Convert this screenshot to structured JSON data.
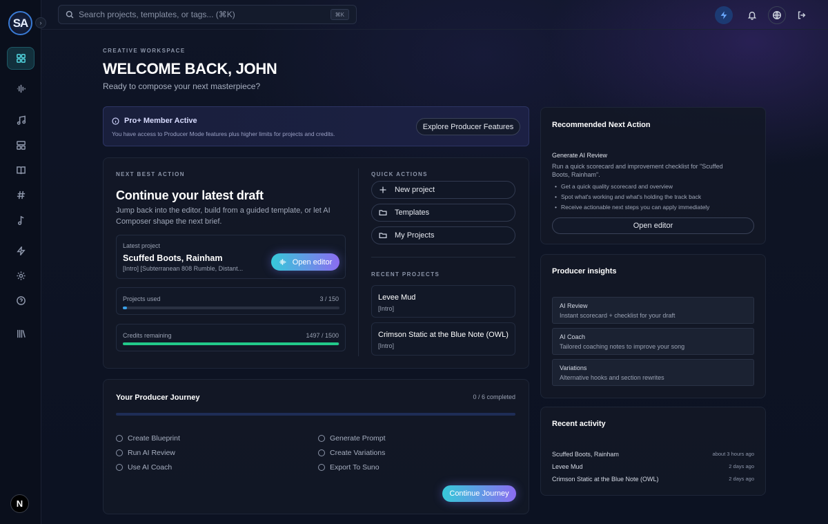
{
  "app": {
    "logo_text": "SA"
  },
  "search": {
    "placeholder": "Search projects, templates, or tags... (⌘K)",
    "shortcut": "⌘K"
  },
  "sidebar": {
    "items": [
      {
        "name": "dashboard",
        "icon": "grid-icon",
        "active": true
      },
      {
        "name": "waveform",
        "icon": "waveform-icon"
      },
      {
        "name": "music",
        "icon": "music-note-icon"
      },
      {
        "name": "templates",
        "icon": "layout-icon"
      },
      {
        "name": "guide",
        "icon": "book-icon"
      },
      {
        "name": "tags",
        "icon": "hash-icon"
      },
      {
        "name": "notes",
        "icon": "note-icon"
      },
      {
        "name": "producer",
        "icon": "bolt-icon"
      },
      {
        "name": "settings",
        "icon": "gear-icon"
      },
      {
        "name": "help",
        "icon": "help-icon"
      },
      {
        "name": "library",
        "icon": "library-icon"
      }
    ],
    "user_badge": "N"
  },
  "header": {
    "eyebrow": "CREATIVE WORKSPACE",
    "title": "WELCOME BACK, JOHN",
    "subtitle": "Ready to compose your next masterpiece?"
  },
  "pro_banner": {
    "title": "Pro+ Member Active",
    "description": "You have access to Producer Mode features plus higher limits for projects and credits.",
    "button": "Explore Producer Features"
  },
  "next_action": {
    "eyebrow": "NEXT BEST ACTION",
    "title": "Continue your latest draft",
    "description": "Jump back into the editor, build from a guided template, or let AI Composer shape the next brief.",
    "latest_label": "Latest project",
    "latest_title": "Scuffed Boots, Rainham",
    "latest_snippet": "[Intro] [Subterranean 808 Rumble, Distant...",
    "open_button": "Open editor",
    "projects_used_label": "Projects used",
    "projects_used_value": "3 / 150",
    "projects_used_fraction": 0.02,
    "credits_label": "Credits remaining",
    "credits_value": "1497 / 1500",
    "credits_fraction": 0.998
  },
  "quick_actions": {
    "eyebrow": "QUICK ACTIONS",
    "items": [
      "New project",
      "Templates",
      "My Projects"
    ]
  },
  "recent_projects": {
    "eyebrow": "RECENT PROJECTS",
    "items": [
      {
        "title": "Levee Mud",
        "tag": "[Intro]"
      },
      {
        "title": "Crimson Static at the Blue Note (OWL)",
        "tag": "[Intro]"
      }
    ]
  },
  "journey": {
    "title": "Your Producer Journey",
    "status": "0 / 6 completed",
    "progress_fraction": 0,
    "steps": [
      "Create Blueprint",
      "Generate Prompt",
      "Run AI Review",
      "Create Variations",
      "Use AI Coach",
      "Export To Suno"
    ],
    "button": "Continue Journey"
  },
  "recommended": {
    "title": "Recommended Next Action",
    "action_title": "Generate AI Review",
    "action_desc": "Run a quick scorecard and improvement checklist for \"Scuffed Boots, Rainham\".",
    "bullets": [
      "Get a quick quality scorecard and overview",
      "Spot what's working and what's holding the track back",
      "Receive actionable next steps you can apply immediately"
    ],
    "button": "Open editor"
  },
  "insights": {
    "title": "Producer insights",
    "items": [
      {
        "title": "AI Review",
        "desc": "Instant scorecard + checklist for your draft"
      },
      {
        "title": "AI Coach",
        "desc": "Tailored coaching notes to improve your song"
      },
      {
        "title": "Variations",
        "desc": "Alternative hooks and section rewrites"
      }
    ]
  },
  "activity": {
    "title": "Recent activity",
    "items": [
      {
        "name": "Scuffed Boots, Rainham",
        "time": "about 3 hours ago"
      },
      {
        "name": "Levee Mud",
        "time": "2 days ago"
      },
      {
        "name": "Crimson Static at the Blue Note (OWL)",
        "time": "2 days ago"
      }
    ]
  },
  "colors": {
    "accent_cyan": "#36c9d9",
    "accent_violet": "#8b6cf0",
    "credits_green": "#22c98a",
    "projects_blue": "#3aa0e8"
  }
}
